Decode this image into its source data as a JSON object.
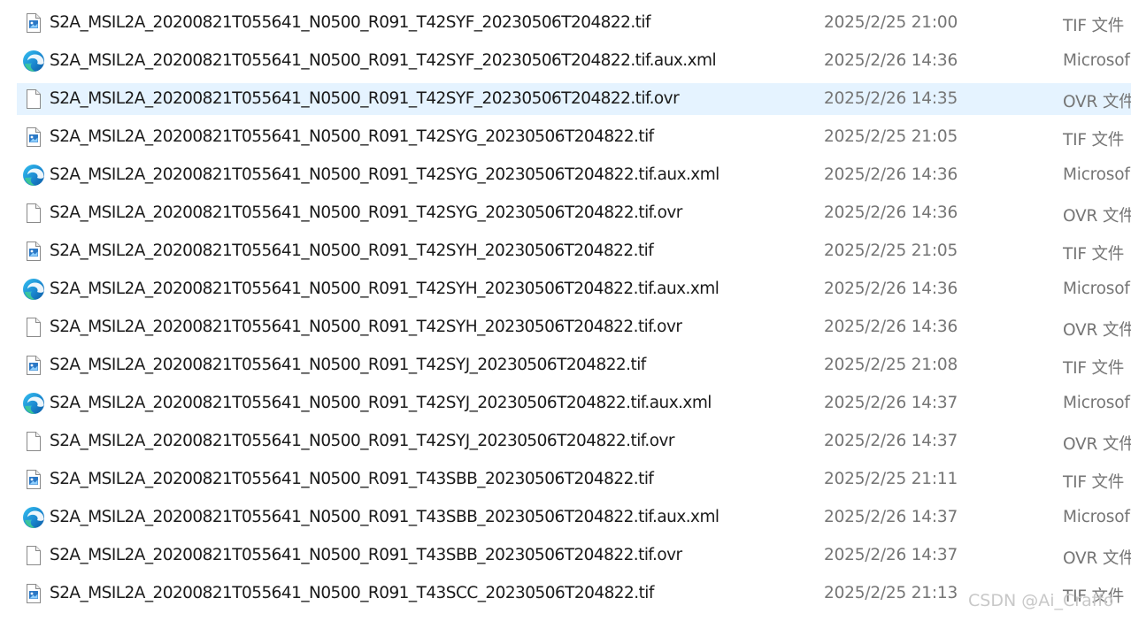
{
  "files": [
    {
      "name": "S2A_MSIL2A_20200821T055641_N0500_R091_T42SYF_20230506T204822.tif",
      "date": "2025/2/25 21:00",
      "type": "TIF 文件",
      "icon": "tif-image-icon",
      "selected": false
    },
    {
      "name": "S2A_MSIL2A_20200821T055641_N0500_R091_T42SYF_20230506T204822.tif.aux.xml",
      "date": "2025/2/26 14:36",
      "type": "Microsof",
      "icon": "edge-browser-icon",
      "selected": false
    },
    {
      "name": "S2A_MSIL2A_20200821T055641_N0500_R091_T42SYF_20230506T204822.tif.ovr",
      "date": "2025/2/26 14:35",
      "type": "OVR 文件",
      "icon": "blank-file-icon",
      "selected": true
    },
    {
      "name": "S2A_MSIL2A_20200821T055641_N0500_R091_T42SYG_20230506T204822.tif",
      "date": "2025/2/25 21:05",
      "type": "TIF 文件",
      "icon": "tif-image-icon",
      "selected": false
    },
    {
      "name": "S2A_MSIL2A_20200821T055641_N0500_R091_T42SYG_20230506T204822.tif.aux.xml",
      "date": "2025/2/26 14:36",
      "type": "Microsof",
      "icon": "edge-browser-icon",
      "selected": false
    },
    {
      "name": "S2A_MSIL2A_20200821T055641_N0500_R091_T42SYG_20230506T204822.tif.ovr",
      "date": "2025/2/26 14:36",
      "type": "OVR 文件",
      "icon": "blank-file-icon",
      "selected": false
    },
    {
      "name": "S2A_MSIL2A_20200821T055641_N0500_R091_T42SYH_20230506T204822.tif",
      "date": "2025/2/25 21:05",
      "type": "TIF 文件",
      "icon": "tif-image-icon",
      "selected": false
    },
    {
      "name": "S2A_MSIL2A_20200821T055641_N0500_R091_T42SYH_20230506T204822.tif.aux.xml",
      "date": "2025/2/26 14:36",
      "type": "Microsof",
      "icon": "edge-browser-icon",
      "selected": false
    },
    {
      "name": "S2A_MSIL2A_20200821T055641_N0500_R091_T42SYH_20230506T204822.tif.ovr",
      "date": "2025/2/26 14:36",
      "type": "OVR 文件",
      "icon": "blank-file-icon",
      "selected": false
    },
    {
      "name": "S2A_MSIL2A_20200821T055641_N0500_R091_T42SYJ_20230506T204822.tif",
      "date": "2025/2/25 21:08",
      "type": "TIF 文件",
      "icon": "tif-image-icon",
      "selected": false
    },
    {
      "name": "S2A_MSIL2A_20200821T055641_N0500_R091_T42SYJ_20230506T204822.tif.aux.xml",
      "date": "2025/2/26 14:37",
      "type": "Microsof",
      "icon": "edge-browser-icon",
      "selected": false
    },
    {
      "name": "S2A_MSIL2A_20200821T055641_N0500_R091_T42SYJ_20230506T204822.tif.ovr",
      "date": "2025/2/26 14:37",
      "type": "OVR 文件",
      "icon": "blank-file-icon",
      "selected": false
    },
    {
      "name": "S2A_MSIL2A_20200821T055641_N0500_R091_T43SBB_20230506T204822.tif",
      "date": "2025/2/25 21:11",
      "type": "TIF 文件",
      "icon": "tif-image-icon",
      "selected": false
    },
    {
      "name": "S2A_MSIL2A_20200821T055641_N0500_R091_T43SBB_20230506T204822.tif.aux.xml",
      "date": "2025/2/26 14:37",
      "type": "Microsof",
      "icon": "edge-browser-icon",
      "selected": false
    },
    {
      "name": "S2A_MSIL2A_20200821T055641_N0500_R091_T43SBB_20230506T204822.tif.ovr",
      "date": "2025/2/26 14:37",
      "type": "OVR 文件",
      "icon": "blank-file-icon",
      "selected": false
    },
    {
      "name": "S2A_MSIL2A_20200821T055641_N0500_R091_T43SCC_20230506T204822.tif",
      "date": "2025/2/25 21:13",
      "type": "TIF 文件",
      "icon": "tif-image-icon",
      "selected": false
    }
  ],
  "watermark": "CSDN @Ai_Craffo",
  "colors": {
    "selected_row": "#e5f3ff",
    "secondary_text": "#757575",
    "edge_blue": "#0c59a4",
    "edge_green": "#35c1f1",
    "tif_blue": "#2b78c5"
  }
}
